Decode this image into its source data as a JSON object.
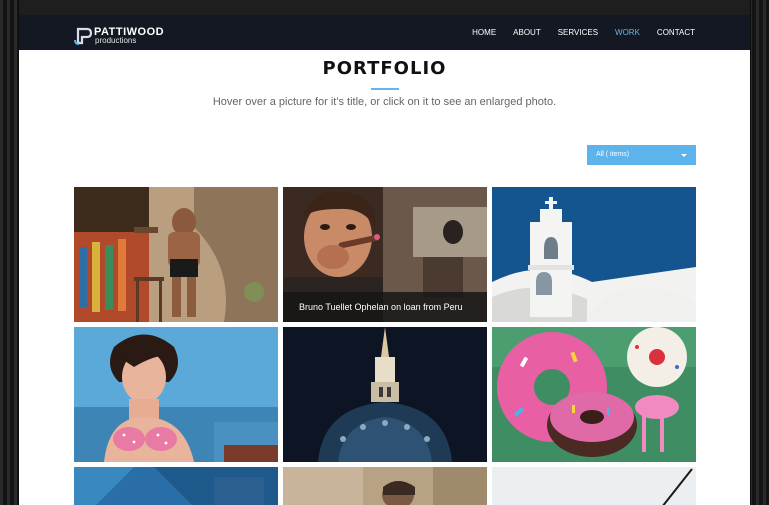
{
  "brand": {
    "name": "PATTIWOOD",
    "sub": "productions"
  },
  "nav": {
    "items": [
      "HOME",
      "ABOUT",
      "SERVICES",
      "WORK",
      "CONTACT"
    ],
    "active": "WORK"
  },
  "header": {
    "title": "PORTFOLIO",
    "subtitle": "Hover over a picture for it's title, or click on it to see an enlarged photo."
  },
  "filter": {
    "label": "All ( items)"
  },
  "gallery": {
    "hover_caption": "Bruno Tuellet Ophelan on loan from Peru"
  },
  "colors": {
    "accent": "#64b6ee",
    "navbar": "#141822",
    "filter": "#5db3ec"
  }
}
